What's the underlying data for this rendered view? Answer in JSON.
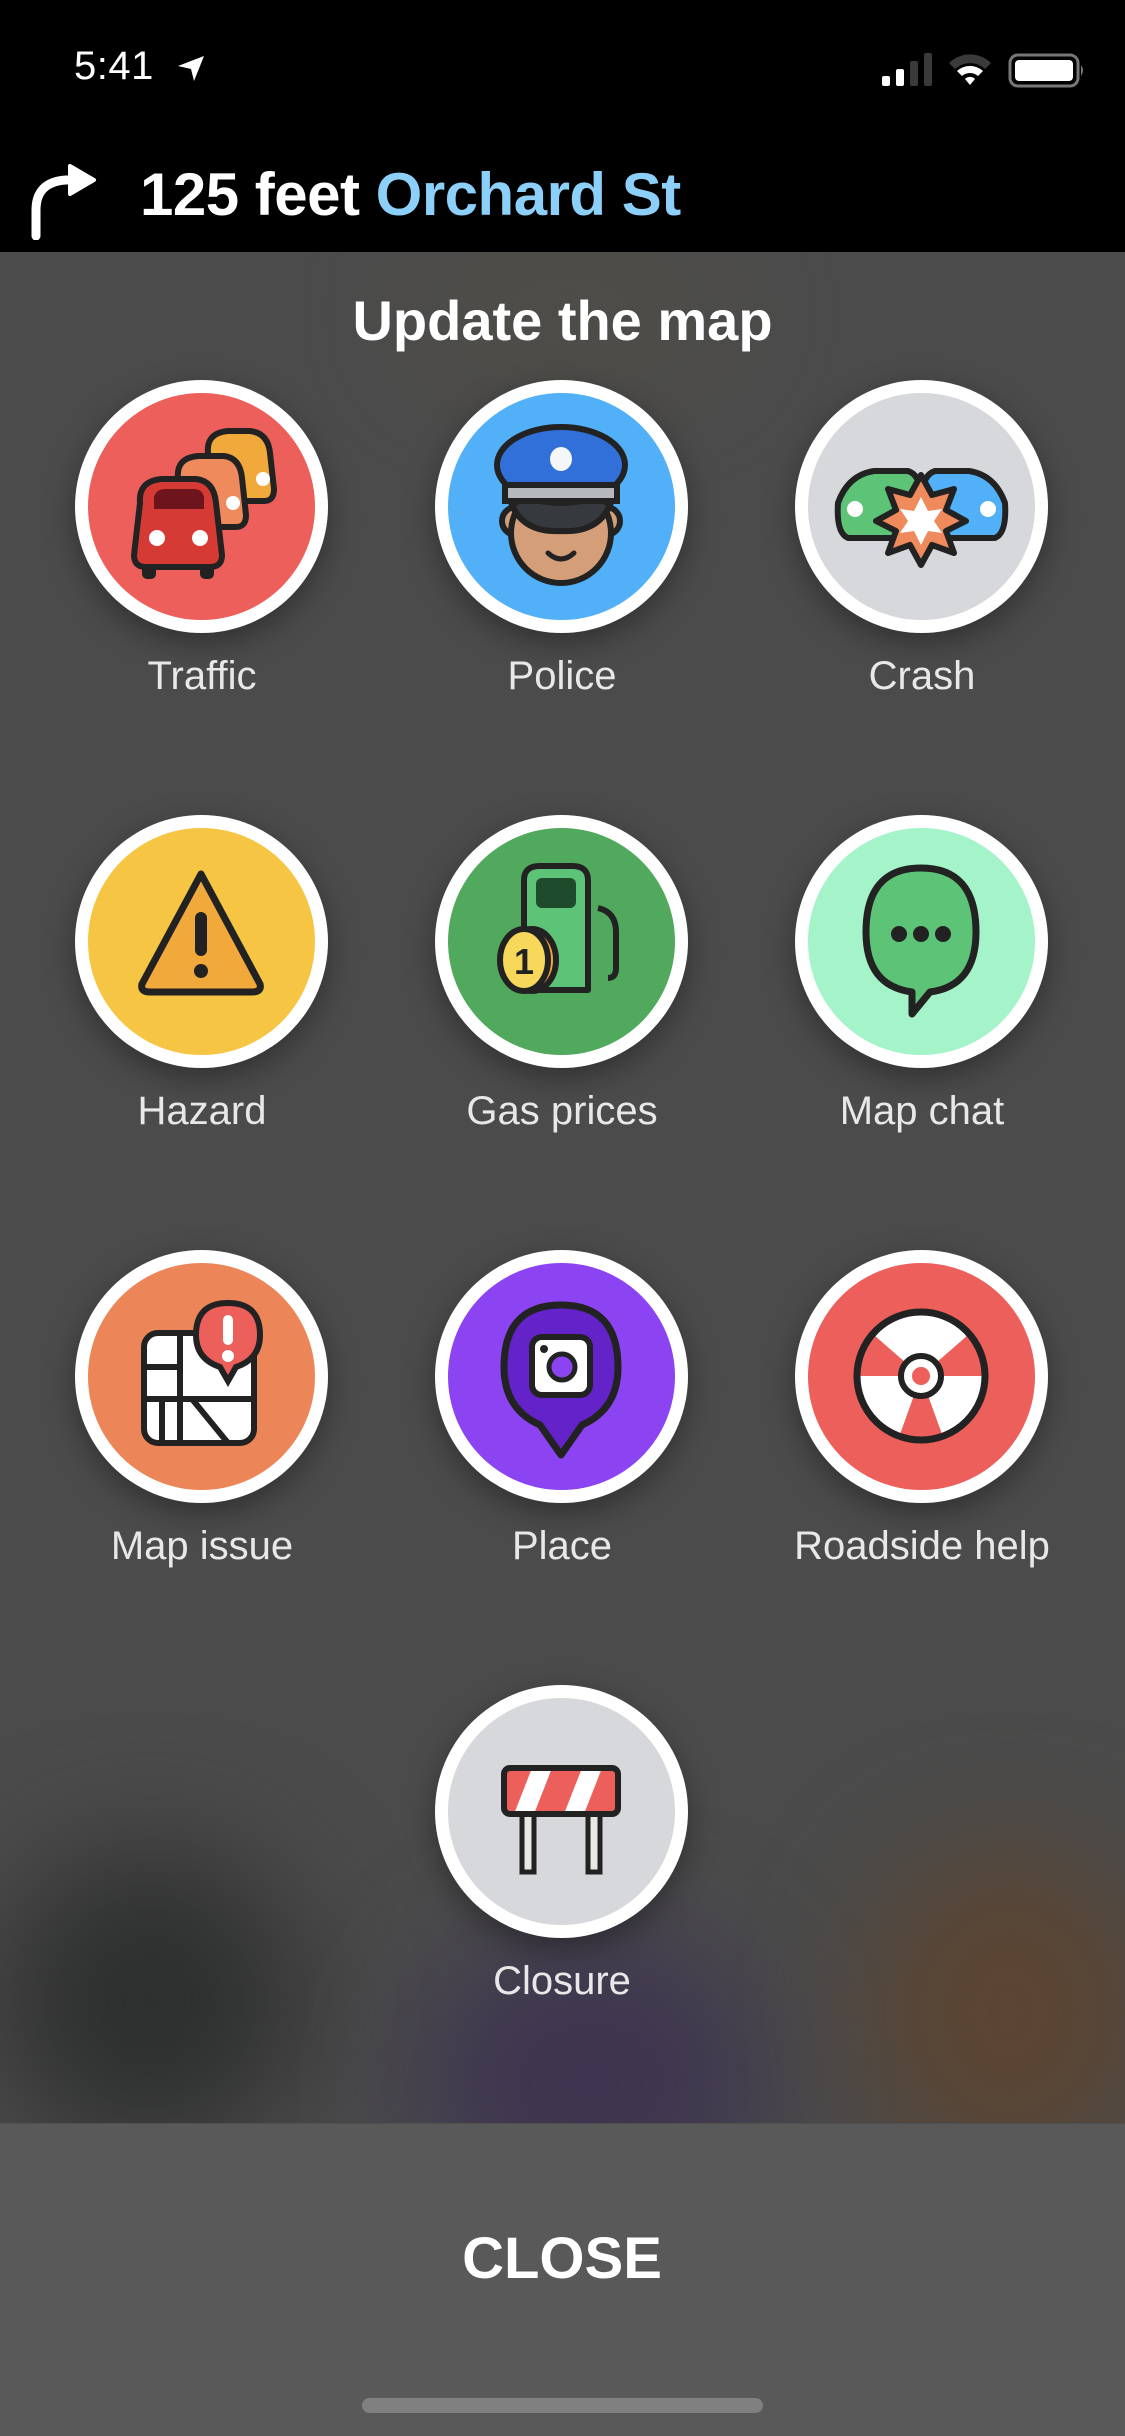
{
  "status_bar": {
    "time": "5:41",
    "location_icon": "location-arrow-icon",
    "signal_bars_active": 2,
    "signal_bars_total": 4,
    "wifi_icon": "wifi-icon",
    "battery_icon": "battery-icon"
  },
  "navigation": {
    "turn_icon": "turn-right-icon",
    "distance": "125 feet",
    "street": "Orchard St",
    "street_color": "#8ccff9"
  },
  "sheet": {
    "title": "Update the map",
    "items": [
      {
        "id": "traffic",
        "label": "Traffic",
        "icon": "traffic-cars-icon",
        "bg": "#ec5f5b"
      },
      {
        "id": "police",
        "label": "Police",
        "icon": "police-officer-icon",
        "bg": "#51b0f7"
      },
      {
        "id": "crash",
        "label": "Crash",
        "icon": "crash-icon",
        "bg": "#d7d8dc"
      },
      {
        "id": "hazard",
        "label": "Hazard",
        "icon": "hazard-warning-icon",
        "bg": "#f6c544"
      },
      {
        "id": "gas",
        "label": "Gas prices",
        "icon": "gas-pump-icon",
        "bg": "#51a95d"
      },
      {
        "id": "mapchat",
        "label": "Map chat",
        "icon": "chat-bubble-icon",
        "bg": "#a5f3c8"
      },
      {
        "id": "mapissue",
        "label": "Map issue",
        "icon": "map-issue-icon",
        "bg": "#ec8658"
      },
      {
        "id": "place",
        "label": "Place",
        "icon": "place-camera-pin-icon",
        "bg": "#8c44f2"
      },
      {
        "id": "roadside",
        "label": "Roadside help",
        "icon": "tire-icon",
        "bg": "#ec5f5b"
      },
      {
        "id": "closure",
        "label": "Closure",
        "icon": "road-barrier-icon",
        "bg": "#d7d8dc"
      }
    ],
    "close_label": "CLOSE"
  }
}
